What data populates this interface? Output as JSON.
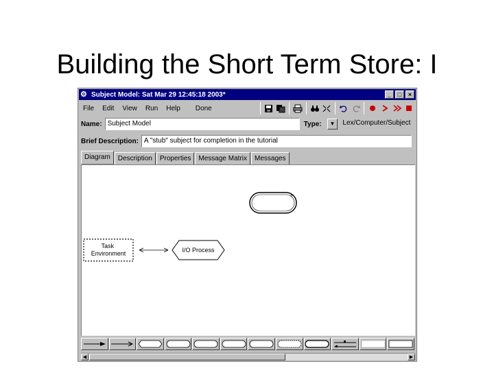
{
  "slide": {
    "title": "Building the Short Term Store: I"
  },
  "window": {
    "title": "Subject Model: Sat Mar 29 12:45:18 2003*",
    "controls": {
      "minimize": "_",
      "maximize": "□",
      "close": "×"
    }
  },
  "menu": [
    "File",
    "Edit",
    "View",
    "Run",
    "Help",
    "Done"
  ],
  "toolbar": {
    "icons": [
      "save-icon",
      "copy-icon",
      "print-icon",
      "find-icon",
      "layout-icon",
      "undo-icon",
      "redo-icon",
      "record-icon",
      "step-icon",
      "fast-forward-icon",
      "stop-icon"
    ],
    "accent_color": "#cc0000"
  },
  "form": {
    "name_label": "Name:",
    "name_value": "Subject Model",
    "type_label": "Type:",
    "type_value": "Lex/Computer/Subject",
    "brief_label": "Brief Description:",
    "brief_value": "A \"stub\" subject for completion in the tutorial"
  },
  "tabs": [
    "Diagram",
    "Description",
    "Properties",
    "Message Matrix",
    "Messages"
  ],
  "diagram": {
    "task_environment": "Task Environment",
    "io_process": "I/O Process"
  },
  "palette": {
    "tools": [
      "arrow-tool-icon",
      "open-arrow-tool-icon",
      "process-tool-icon",
      "store-tool-icon",
      "store-tool-icon",
      "store-tool-icon",
      "store-tool-icon",
      "dashed-store-tool-icon",
      "rounded-store-tool-icon",
      "connector-tool-icon",
      "hatched-box-tool-icon",
      "box-tool-icon"
    ]
  }
}
